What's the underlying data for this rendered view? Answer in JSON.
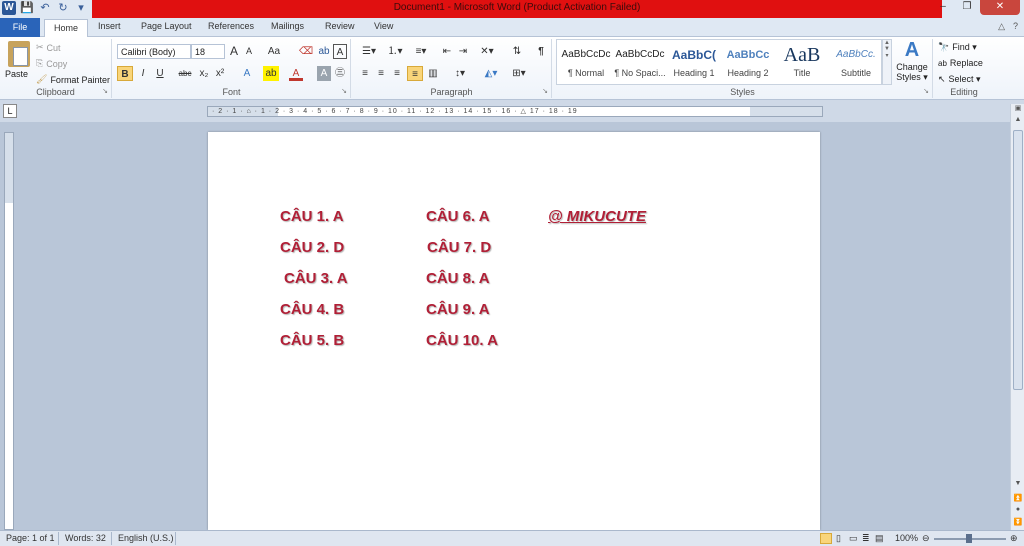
{
  "window": {
    "title": "Document1 - Microsoft Word (Product Activation Failed)",
    "controls": [
      "–",
      "❐",
      "✕"
    ]
  },
  "qat": {
    "logo": "W",
    "save": "💾",
    "undo": "↶",
    "redo": "↻",
    "more": "▾"
  },
  "tabs": [
    {
      "label": "File"
    },
    {
      "label": "Home"
    },
    {
      "label": "Insert"
    },
    {
      "label": "Page Layout"
    },
    {
      "label": "References"
    },
    {
      "label": "Mailings"
    },
    {
      "label": "Review"
    },
    {
      "label": "View"
    }
  ],
  "tab_right": {
    "help": "?",
    "minimize_ribbon": "△"
  },
  "ribbon": {
    "clipboard": {
      "label": "Clipboard",
      "paste": "Paste",
      "cut": "Cut",
      "copy": "Copy",
      "format_painter": "Format Painter"
    },
    "font": {
      "label": "Font",
      "family": "Calibri (Body)",
      "size": "18",
      "grow": "A",
      "shrink": "A",
      "case": "Aa",
      "clear": "A",
      "bold": "B",
      "italic": "I",
      "underline": "U",
      "strike": "abc",
      "subscript": "x₂",
      "superscript": "x²"
    },
    "paragraph": {
      "label": "Paragraph",
      "pilcrow": "¶"
    },
    "styles": {
      "label": "Styles",
      "items": [
        {
          "sample": "AaBbCcDc",
          "name": "¶ Normal"
        },
        {
          "sample": "AaBbCcDc",
          "name": "¶ No Spaci..."
        },
        {
          "sample": "AaBbC(",
          "name": "Heading 1"
        },
        {
          "sample": "AaBbCc",
          "name": "Heading 2"
        },
        {
          "sample": "AaB",
          "name": "Title"
        },
        {
          "sample": "AaBbCc.",
          "name": "Subtitle"
        }
      ],
      "change_styles": "Change Styles ▾"
    },
    "editing": {
      "label": "Editing",
      "find": "Find ▾",
      "replace": "Replace",
      "select": "Select ▾"
    }
  },
  "ruler": {
    "marks": "· 2 · 1 · ⌂ · 1 · 2 · 3 · 4 · 5 · 6 · 7 · 8 · 9 · 10 · 11 · 12 · 13 · 14 · 15 · 16 · △ 17 · 18 · 19"
  },
  "document": {
    "col1": [
      "CÂU 1. A",
      "CÂU 2. D",
      "CÂU 3. A",
      "CÂU 4. B",
      "CÂU 5. B"
    ],
    "col2": [
      "CÂU 6. A",
      "CÂU 7. D",
      "CÂU 8. A",
      "CÂU 9. A",
      "CÂU 10. A"
    ],
    "signature": "@ MIKUCUTE"
  },
  "statusbar": {
    "page": "Page: 1 of 1",
    "words": "Words: 32",
    "language": "English (U.S.)",
    "zoom": "100%"
  }
}
